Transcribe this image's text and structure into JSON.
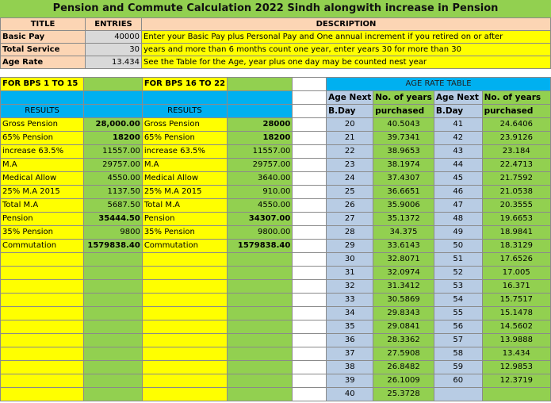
{
  "title": "Pension and Commute Calculation 2022 Sindh alongwith increase in Pension",
  "inputs": {
    "col_title": "TITLE",
    "col_entries": "ENTRIES",
    "col_description": "DESCRIPTION",
    "rows": [
      {
        "label": "Basic Pay",
        "value": "40000",
        "desc": "Enter your Basic Pay plus Personal Pay and One annual increment  if you retired on or after"
      },
      {
        "label": "Total Service",
        "value": "30",
        "desc": "years and more than 6 months count one year, enter  years 30 for more than 30"
      },
      {
        "label": "Age Rate",
        "value": "13.434",
        "desc": "See the Table for the Age, year plus one day may be counted nest year"
      }
    ]
  },
  "bps1": {
    "header": "FOR BPS 1 TO 15",
    "results_label": "RESULTS"
  },
  "bps2": {
    "header": "FOR BPS 16 TO 22",
    "results_label": "RESULTS"
  },
  "results": [
    {
      "l1": "Gross Pension",
      "v1": "28,000.00",
      "l2": "Gross Pension",
      "v2": "28000"
    },
    {
      "l1": "65% Pension",
      "v1": "18200",
      "l2": "65% Pension",
      "v2": "18200"
    },
    {
      "l1": "increase 63.5%",
      "v1": "11557.00",
      "l2": "increase 63.5%",
      "v2": "11557.00"
    },
    {
      "l1": "M.A",
      "v1": "29757.00",
      "l2": "M.A",
      "v2": "29757.00"
    },
    {
      "l1": "Medical Allow",
      "v1": "4550.00",
      "l2": "Medical Allow",
      "v2": "3640.00"
    },
    {
      "l1": "25% M.A 2015",
      "v1": "1137.50",
      "l2": "25% M.A 2015",
      "v2": "910.00"
    },
    {
      "l1": "Total M.A",
      "v1": "5687.50",
      "l2": "Total M.A",
      "v2": "4550.00"
    },
    {
      "l1": "Pension",
      "v1": "35444.50",
      "l2": "Pension",
      "v2": "34307.00"
    },
    {
      "l1": "35% Pension",
      "v1": "9800",
      "l2": "35% Pension",
      "v2": "9800.00"
    },
    {
      "l1": "Commutation",
      "v1": "1579838.40",
      "l2": "Commutation",
      "v2": "1579838.40"
    }
  ],
  "age_table": {
    "title": "AGE RATE TABLE",
    "h_age": "Age Next",
    "h_bday": "B.Day",
    "h_years": "No. of years",
    "h_purchased": "purchased",
    "rows": [
      {
        "a1": "20",
        "p1": "40.5043",
        "a2": "41",
        "p2": "24.6406"
      },
      {
        "a1": "21",
        "p1": "39.7341",
        "a2": "42",
        "p2": "23.9126"
      },
      {
        "a1": "22",
        "p1": "38.9653",
        "a2": "43",
        "p2": "23.184"
      },
      {
        "a1": "23",
        "p1": "38.1974",
        "a2": "44",
        "p2": "22.4713"
      },
      {
        "a1": "24",
        "p1": "37.4307",
        "a2": "45",
        "p2": "21.7592"
      },
      {
        "a1": "25",
        "p1": "36.6651",
        "a2": "46",
        "p2": "21.0538"
      },
      {
        "a1": "26",
        "p1": "35.9006",
        "a2": "47",
        "p2": "20.3555"
      },
      {
        "a1": "27",
        "p1": "35.1372",
        "a2": "48",
        "p2": "19.6653"
      },
      {
        "a1": "28",
        "p1": "34.375",
        "a2": "49",
        "p2": "18.9841"
      },
      {
        "a1": "29",
        "p1": "33.6143",
        "a2": "50",
        "p2": "18.3129"
      },
      {
        "a1": "30",
        "p1": "32.8071",
        "a2": "51",
        "p2": "17.6526"
      },
      {
        "a1": "31",
        "p1": "32.0974",
        "a2": "52",
        "p2": "17.005"
      },
      {
        "a1": "32",
        "p1": "31.3412",
        "a2": "53",
        "p2": "16.371"
      },
      {
        "a1": "33",
        "p1": "30.5869",
        "a2": "54",
        "p2": "15.7517"
      },
      {
        "a1": "34",
        "p1": "29.8343",
        "a2": "55",
        "p2": "15.1478"
      },
      {
        "a1": "35",
        "p1": "29.0841",
        "a2": "56",
        "p2": "14.5602"
      },
      {
        "a1": "36",
        "p1": "28.3362",
        "a2": "57",
        "p2": "13.9888"
      },
      {
        "a1": "37",
        "p1": "27.5908",
        "a2": "58",
        "p2": "13.434"
      },
      {
        "a1": "38",
        "p1": "26.8482",
        "a2": "59",
        "p2": "12.9853"
      },
      {
        "a1": "39",
        "p1": "26.1009",
        "a2": "60",
        "p2": "12.3719"
      },
      {
        "a1": "40",
        "p1": "25.3728",
        "a2": "",
        "p2": ""
      }
    ]
  }
}
